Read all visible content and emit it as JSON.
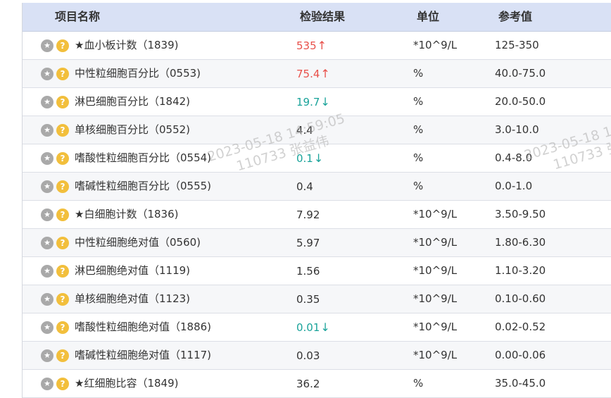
{
  "headers": {
    "name": "项目名称",
    "result": "检验结果",
    "unit": "单位",
    "ref": "参考值"
  },
  "icons": {
    "star": "★",
    "help": "?"
  },
  "colors": {
    "header_bg": "#d9e1f5",
    "high": "#e8504a",
    "low": "#1aa39a",
    "star_button": "#a9a9a9",
    "help_button": "#f2bf3c"
  },
  "rows": [
    {
      "name": "★血小板计数（1839)",
      "result": "535",
      "flag": "↑",
      "status": "high",
      "unit": "*10^9/L",
      "ref": "125-350"
    },
    {
      "name": "中性粒细胞百分比（0553)",
      "result": "75.4",
      "flag": "↑",
      "status": "high",
      "unit": "%",
      "ref": "40.0-75.0"
    },
    {
      "name": "淋巴细胞百分比（1842)",
      "result": "19.7",
      "flag": "↓",
      "status": "low",
      "unit": "%",
      "ref": "20.0-50.0"
    },
    {
      "name": "单核细胞百分比（0552)",
      "result": "4.4",
      "flag": "",
      "status": "normal",
      "unit": "%",
      "ref": "3.0-10.0"
    },
    {
      "name": "嗜酸性粒细胞百分比（0554)",
      "result": "0.1",
      "flag": "↓",
      "status": "low",
      "unit": "%",
      "ref": "0.4-8.0"
    },
    {
      "name": "嗜碱性粒细胞百分比（0555)",
      "result": "0.4",
      "flag": "",
      "status": "normal",
      "unit": "%",
      "ref": "0.0-1.0"
    },
    {
      "name": "★白细胞计数（1836)",
      "result": "7.92",
      "flag": "",
      "status": "normal",
      "unit": "*10^9/L",
      "ref": "3.50-9.50"
    },
    {
      "name": "中性粒细胞绝对值（0560)",
      "result": "5.97",
      "flag": "",
      "status": "normal",
      "unit": "*10^9/L",
      "ref": "1.80-6.30"
    },
    {
      "name": "淋巴细胞绝对值（1119)",
      "result": "1.56",
      "flag": "",
      "status": "normal",
      "unit": "*10^9/L",
      "ref": "1.10-3.20"
    },
    {
      "name": "单核细胞绝对值（1123)",
      "result": "0.35",
      "flag": "",
      "status": "normal",
      "unit": "*10^9/L",
      "ref": "0.10-0.60"
    },
    {
      "name": "嗜酸性粒细胞绝对值（1886)",
      "result": "0.01",
      "flag": "↓",
      "status": "low",
      "unit": "*10^9/L",
      "ref": "0.02-0.52"
    },
    {
      "name": "嗜碱性粒细胞绝对值（1117)",
      "result": "0.03",
      "flag": "",
      "status": "normal",
      "unit": "*10^9/L",
      "ref": "0.00-0.06"
    },
    {
      "name": "★红细胞比容（1849)",
      "result": "36.2",
      "flag": "",
      "status": "normal",
      "unit": "%",
      "ref": "35.0-45.0"
    }
  ],
  "watermark": {
    "line1": "2023-05-18 14:59:05",
    "line2": "110733 张益伟",
    "line1_partial": "2023-05-18 1",
    "line2_partial": "110733 张"
  }
}
